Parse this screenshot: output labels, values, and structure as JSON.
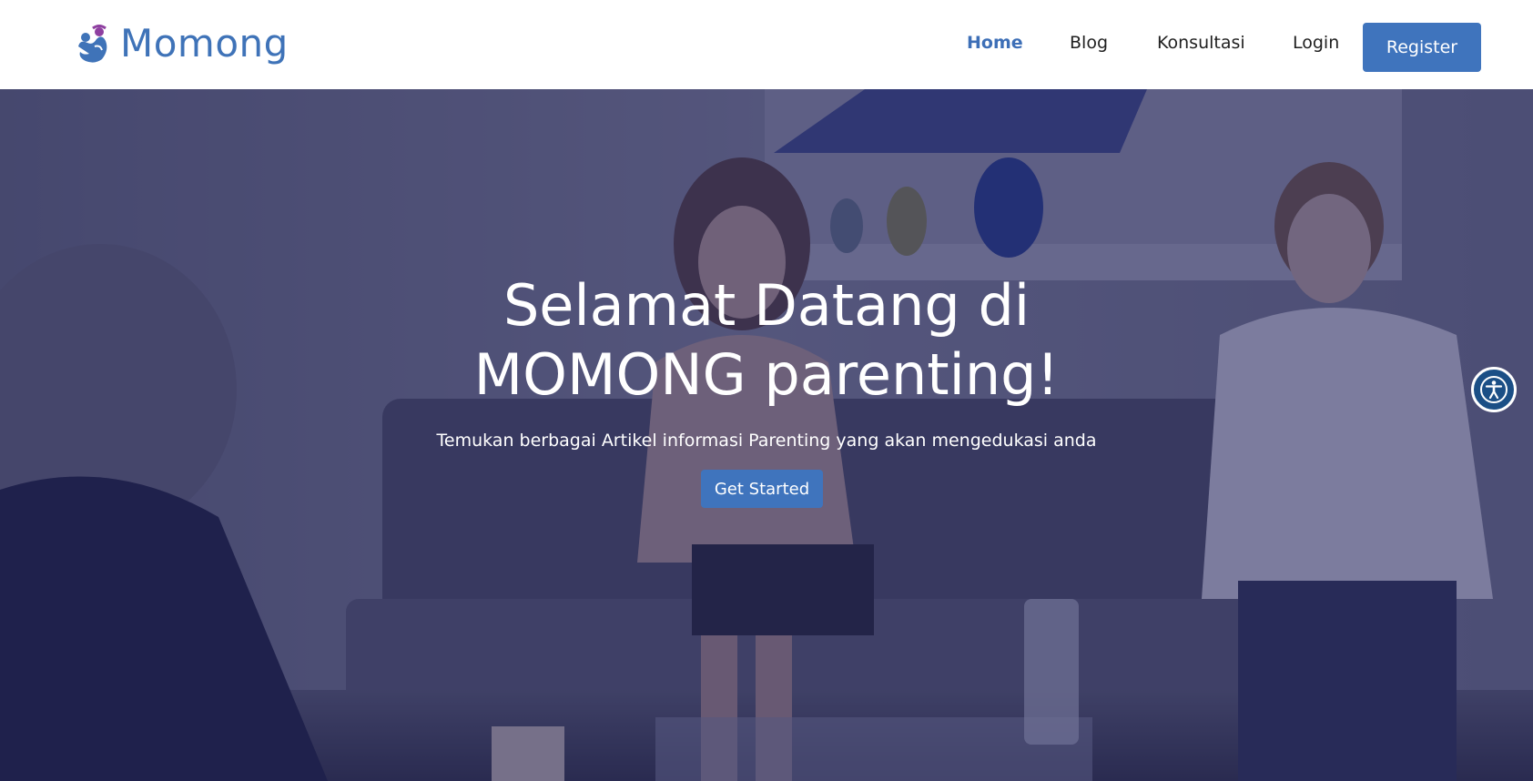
{
  "brand": {
    "name": "Momong",
    "color": "#3f73b8"
  },
  "nav": {
    "items": [
      {
        "label": "Home",
        "active": true
      },
      {
        "label": "Blog",
        "active": false
      },
      {
        "label": "Konsultasi",
        "active": false
      },
      {
        "label": "Login",
        "active": false
      }
    ],
    "register_label": "Register"
  },
  "hero": {
    "title_line1": "Selamat Datang di",
    "title_line2": "MOMONG parenting!",
    "subtitle": "Temukan berbagai Artikel informasi Parenting yang akan mengedukasi anda",
    "cta_label": "Get Started",
    "overlay_color": "#26285e"
  },
  "accessibility": {
    "icon": "accessibility-icon"
  },
  "colors": {
    "accent": "#3f74bd",
    "active_nav": "#3d6fb7"
  }
}
